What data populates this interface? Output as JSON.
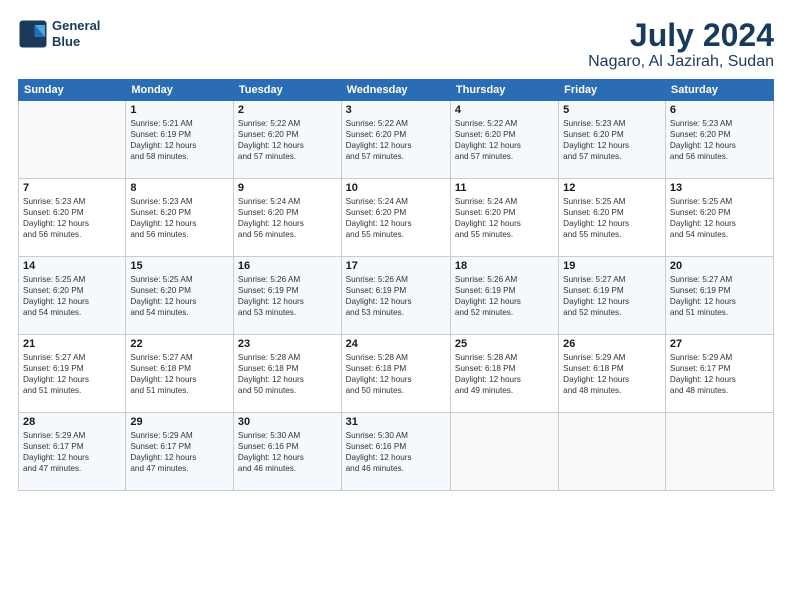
{
  "logo": {
    "line1": "General",
    "line2": "Blue"
  },
  "header": {
    "month": "July 2024",
    "location": "Nagaro, Al Jazirah, Sudan"
  },
  "weekdays": [
    "Sunday",
    "Monday",
    "Tuesday",
    "Wednesday",
    "Thursday",
    "Friday",
    "Saturday"
  ],
  "weeks": [
    [
      {
        "day": "",
        "info": ""
      },
      {
        "day": "1",
        "info": "Sunrise: 5:21 AM\nSunset: 6:19 PM\nDaylight: 12 hours\nand 58 minutes."
      },
      {
        "day": "2",
        "info": "Sunrise: 5:22 AM\nSunset: 6:20 PM\nDaylight: 12 hours\nand 57 minutes."
      },
      {
        "day": "3",
        "info": "Sunrise: 5:22 AM\nSunset: 6:20 PM\nDaylight: 12 hours\nand 57 minutes."
      },
      {
        "day": "4",
        "info": "Sunrise: 5:22 AM\nSunset: 6:20 PM\nDaylight: 12 hours\nand 57 minutes."
      },
      {
        "day": "5",
        "info": "Sunrise: 5:23 AM\nSunset: 6:20 PM\nDaylight: 12 hours\nand 57 minutes."
      },
      {
        "day": "6",
        "info": "Sunrise: 5:23 AM\nSunset: 6:20 PM\nDaylight: 12 hours\nand 56 minutes."
      }
    ],
    [
      {
        "day": "7",
        "info": "Sunrise: 5:23 AM\nSunset: 6:20 PM\nDaylight: 12 hours\nand 56 minutes."
      },
      {
        "day": "8",
        "info": "Sunrise: 5:23 AM\nSunset: 6:20 PM\nDaylight: 12 hours\nand 56 minutes."
      },
      {
        "day": "9",
        "info": "Sunrise: 5:24 AM\nSunset: 6:20 PM\nDaylight: 12 hours\nand 56 minutes."
      },
      {
        "day": "10",
        "info": "Sunrise: 5:24 AM\nSunset: 6:20 PM\nDaylight: 12 hours\nand 55 minutes."
      },
      {
        "day": "11",
        "info": "Sunrise: 5:24 AM\nSunset: 6:20 PM\nDaylight: 12 hours\nand 55 minutes."
      },
      {
        "day": "12",
        "info": "Sunrise: 5:25 AM\nSunset: 6:20 PM\nDaylight: 12 hours\nand 55 minutes."
      },
      {
        "day": "13",
        "info": "Sunrise: 5:25 AM\nSunset: 6:20 PM\nDaylight: 12 hours\nand 54 minutes."
      }
    ],
    [
      {
        "day": "14",
        "info": "Sunrise: 5:25 AM\nSunset: 6:20 PM\nDaylight: 12 hours\nand 54 minutes."
      },
      {
        "day": "15",
        "info": "Sunrise: 5:25 AM\nSunset: 6:20 PM\nDaylight: 12 hours\nand 54 minutes."
      },
      {
        "day": "16",
        "info": "Sunrise: 5:26 AM\nSunset: 6:19 PM\nDaylight: 12 hours\nand 53 minutes."
      },
      {
        "day": "17",
        "info": "Sunrise: 5:26 AM\nSunset: 6:19 PM\nDaylight: 12 hours\nand 53 minutes."
      },
      {
        "day": "18",
        "info": "Sunrise: 5:26 AM\nSunset: 6:19 PM\nDaylight: 12 hours\nand 52 minutes."
      },
      {
        "day": "19",
        "info": "Sunrise: 5:27 AM\nSunset: 6:19 PM\nDaylight: 12 hours\nand 52 minutes."
      },
      {
        "day": "20",
        "info": "Sunrise: 5:27 AM\nSunset: 6:19 PM\nDaylight: 12 hours\nand 51 minutes."
      }
    ],
    [
      {
        "day": "21",
        "info": "Sunrise: 5:27 AM\nSunset: 6:19 PM\nDaylight: 12 hours\nand 51 minutes."
      },
      {
        "day": "22",
        "info": "Sunrise: 5:27 AM\nSunset: 6:18 PM\nDaylight: 12 hours\nand 51 minutes."
      },
      {
        "day": "23",
        "info": "Sunrise: 5:28 AM\nSunset: 6:18 PM\nDaylight: 12 hours\nand 50 minutes."
      },
      {
        "day": "24",
        "info": "Sunrise: 5:28 AM\nSunset: 6:18 PM\nDaylight: 12 hours\nand 50 minutes."
      },
      {
        "day": "25",
        "info": "Sunrise: 5:28 AM\nSunset: 6:18 PM\nDaylight: 12 hours\nand 49 minutes."
      },
      {
        "day": "26",
        "info": "Sunrise: 5:29 AM\nSunset: 6:18 PM\nDaylight: 12 hours\nand 48 minutes."
      },
      {
        "day": "27",
        "info": "Sunrise: 5:29 AM\nSunset: 6:17 PM\nDaylight: 12 hours\nand 48 minutes."
      }
    ],
    [
      {
        "day": "28",
        "info": "Sunrise: 5:29 AM\nSunset: 6:17 PM\nDaylight: 12 hours\nand 47 minutes."
      },
      {
        "day": "29",
        "info": "Sunrise: 5:29 AM\nSunset: 6:17 PM\nDaylight: 12 hours\nand 47 minutes."
      },
      {
        "day": "30",
        "info": "Sunrise: 5:30 AM\nSunset: 6:16 PM\nDaylight: 12 hours\nand 46 minutes."
      },
      {
        "day": "31",
        "info": "Sunrise: 5:30 AM\nSunset: 6:16 PM\nDaylight: 12 hours\nand 46 minutes."
      },
      {
        "day": "",
        "info": ""
      },
      {
        "day": "",
        "info": ""
      },
      {
        "day": "",
        "info": ""
      }
    ]
  ]
}
